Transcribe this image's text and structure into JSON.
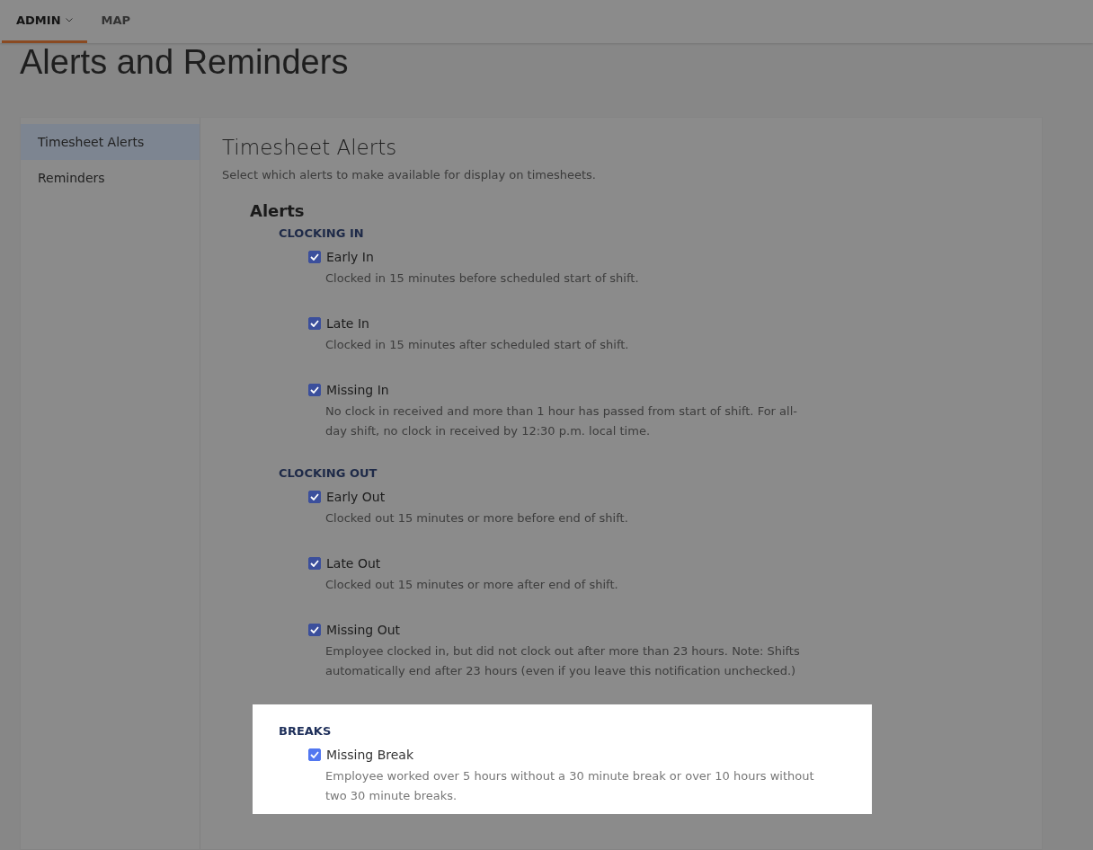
{
  "nav": {
    "items": [
      {
        "label": "ADMIN",
        "selected": true,
        "dropdown": true
      },
      {
        "label": "MAP",
        "selected": false,
        "dropdown": false
      }
    ]
  },
  "page_title": "Alerts and Reminders",
  "sidebar": {
    "items": [
      {
        "label": "Timesheet Alerts",
        "selected": true
      },
      {
        "label": "Reminders",
        "selected": false
      }
    ]
  },
  "content": {
    "title": "Timesheet Alerts",
    "description": "Select which alerts to make available for display on timesheets.",
    "section_title": "Alerts",
    "groups": [
      {
        "title": "CLOCKING IN",
        "highlighted": false,
        "items": [
          {
            "label": "Early In",
            "checked": true,
            "description": "Clocked in 15 minutes before scheduled start of shift."
          },
          {
            "label": "Late In",
            "checked": true,
            "description": "Clocked in 15 minutes after scheduled start of shift."
          },
          {
            "label": "Missing In",
            "checked": true,
            "description": "No clock in received and more than 1 hour has passed from start of shift. For all-day shift, no clock in received by 12:30 p.m. local time."
          }
        ]
      },
      {
        "title": "CLOCKING OUT",
        "highlighted": false,
        "items": [
          {
            "label": "Early Out",
            "checked": true,
            "description": "Clocked out 15 minutes or more before end of shift."
          },
          {
            "label": "Late Out",
            "checked": true,
            "description": "Clocked out 15 minutes or more after end of shift."
          },
          {
            "label": "Missing Out",
            "checked": true,
            "description": "Employee clocked in, but did not clock out after more than 23 hours. Note: Shifts automatically end after 23 hours (even if you leave this notification unchecked.)"
          }
        ]
      },
      {
        "title": "BREAKS",
        "highlighted": true,
        "items": [
          {
            "label": "Missing Break",
            "checked": true,
            "description": "Employee worked over 5 hours without a 30 minute break or over 10 hours without two 30 minute breaks."
          }
        ]
      }
    ]
  }
}
